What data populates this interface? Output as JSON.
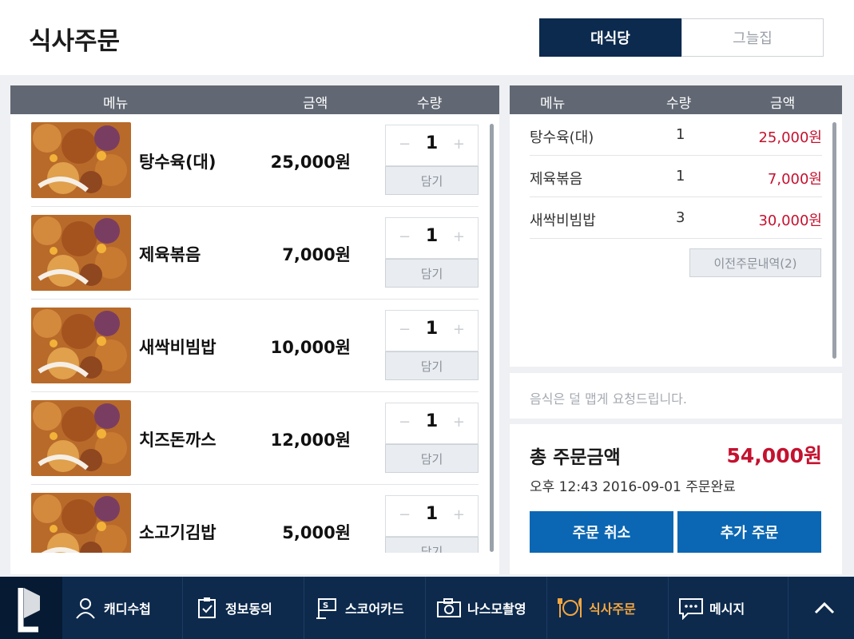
{
  "header": {
    "title": "식사주문",
    "tabs": [
      {
        "label": "대식당",
        "active": true
      },
      {
        "label": "그늘집",
        "active": false
      }
    ]
  },
  "menu_table": {
    "headers": {
      "menu": "메뉴",
      "price": "금액",
      "qty": "수량"
    },
    "add_label": "담기",
    "items": [
      {
        "name": "탕수육(대)",
        "price": "25,000원",
        "qty": "1"
      },
      {
        "name": "제육볶음",
        "price": "7,000원",
        "qty": "1"
      },
      {
        "name": "새싹비빔밥",
        "price": "10,000원",
        "qty": "1"
      },
      {
        "name": "치즈돈까스",
        "price": "12,000원",
        "qty": "1"
      },
      {
        "name": "소고기김밥",
        "price": "5,000원",
        "qty": "1"
      }
    ],
    "minus_symbol": "−",
    "plus_symbol": "+"
  },
  "order_table": {
    "headers": {
      "menu": "메뉴",
      "qty": "수량",
      "price": "금액"
    },
    "rows": [
      {
        "name": "탕수육(대)",
        "qty": "1",
        "price": "25,000원"
      },
      {
        "name": "제육볶음",
        "qty": "1",
        "price": "7,000원"
      },
      {
        "name": "새싹비빔밥",
        "qty": "3",
        "price": "30,000원"
      }
    ],
    "prev_orders_label": "이전주문내역(2)"
  },
  "request_placeholder": "음식은 덜 맵게 요청드립니다.",
  "summary": {
    "total_label": "총 주문금액",
    "total_value": "54,000원",
    "status": "오후 12:43 2016-09-01 주문완료",
    "cancel_label": "주문 취소",
    "add_order_label": "추가 주문"
  },
  "bottom_nav": {
    "items": [
      {
        "label": "캐디수첩",
        "icon": "person-icon"
      },
      {
        "label": "정보동의",
        "icon": "clipboard-check-icon"
      },
      {
        "label": "스코어카드",
        "icon": "flag-scorecard-icon"
      },
      {
        "label": "나스모촬영",
        "icon": "camera-icon"
      },
      {
        "label": "식사주문",
        "icon": "dining-icon",
        "active": true
      },
      {
        "label": "메시지",
        "icon": "chat-icon"
      }
    ]
  },
  "colors": {
    "navy": "#0c2a4e",
    "accent_red": "#c4122f",
    "button_blue": "#0b67b3",
    "nav_active": "#f3a640"
  }
}
